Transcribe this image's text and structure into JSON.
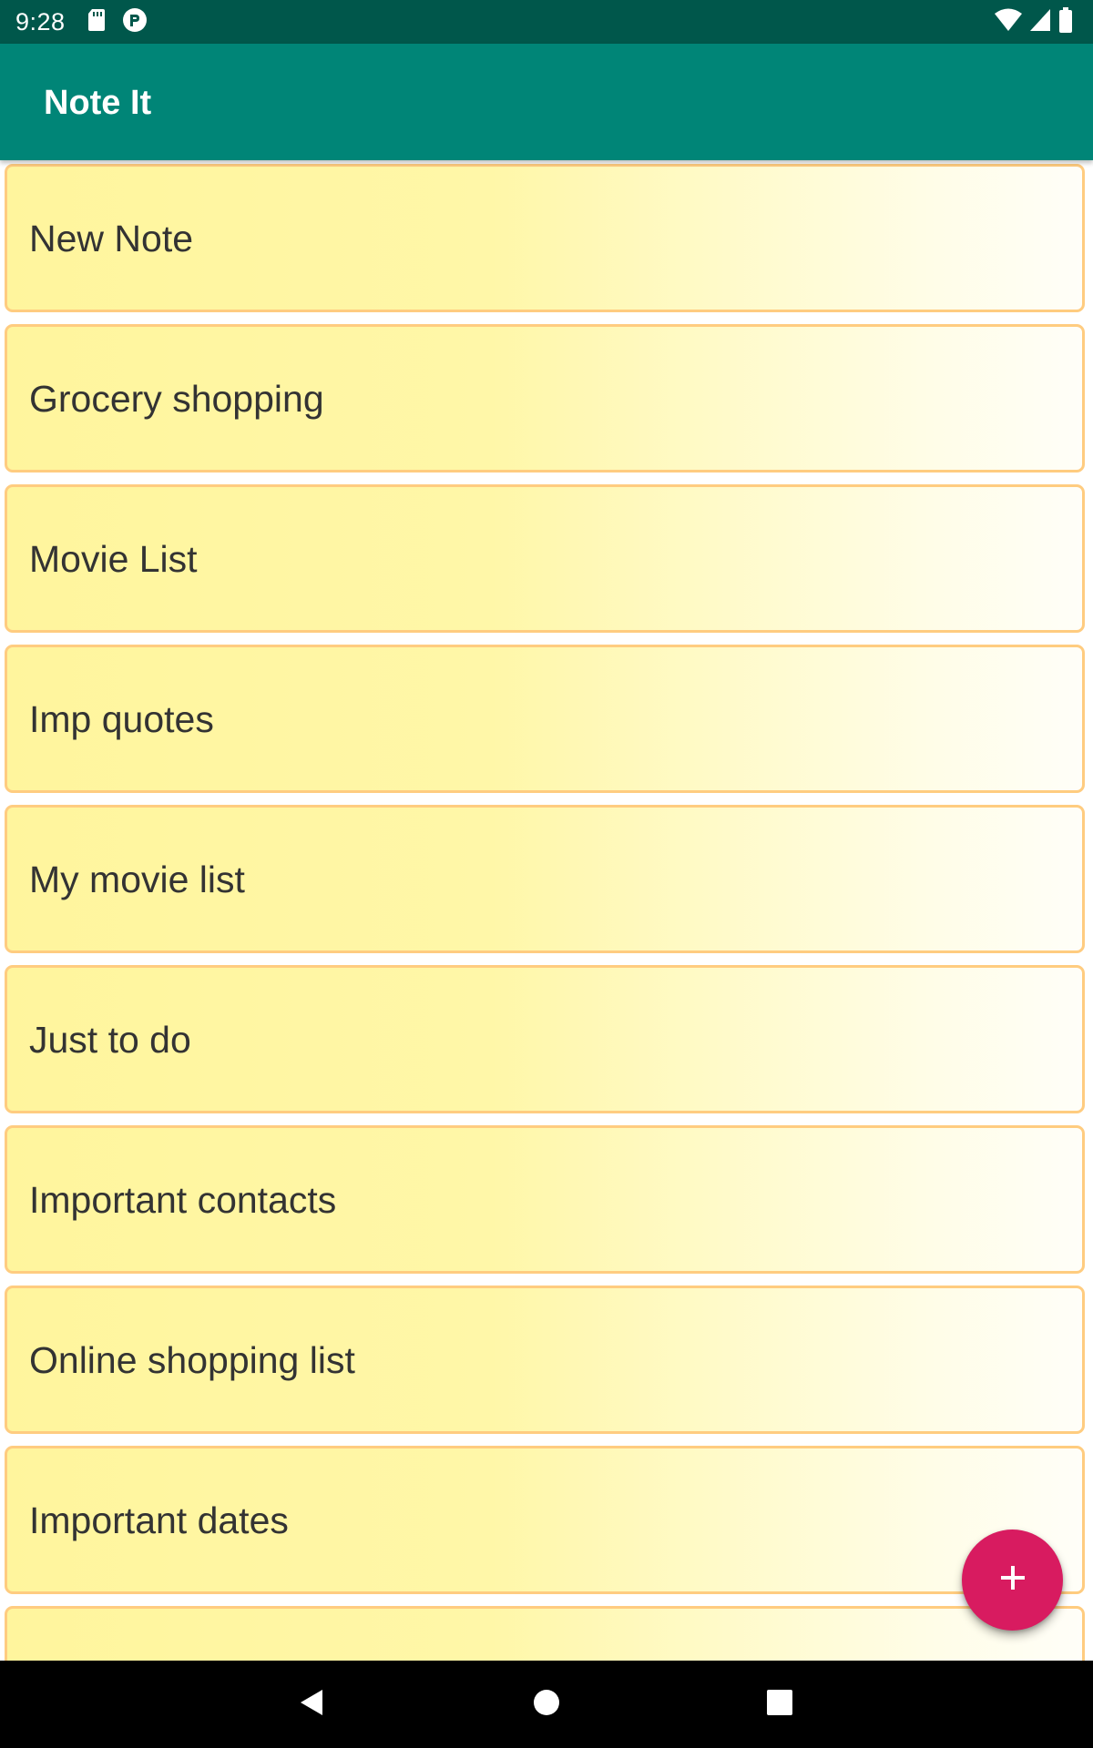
{
  "status_bar": {
    "time": "9:28",
    "left_icons": [
      "sd-card-icon",
      "app-notification-icon"
    ],
    "right_icons": [
      "wifi-icon",
      "cellular-signal-icon",
      "battery-icon"
    ]
  },
  "app_bar": {
    "title": "Note It"
  },
  "notes": [
    {
      "title": "New Note"
    },
    {
      "title": "Grocery shopping"
    },
    {
      "title": "Movie List"
    },
    {
      "title": "Imp quotes"
    },
    {
      "title": "My movie list"
    },
    {
      "title": "Just to do"
    },
    {
      "title": "Important contacts"
    },
    {
      "title": "Online shopping list"
    },
    {
      "title": "Important dates"
    },
    {
      "title": ""
    }
  ],
  "fab": {
    "icon": "plus-icon"
  },
  "nav_bar": {
    "buttons": [
      "back-icon",
      "home-icon",
      "recents-icon"
    ]
  },
  "colors": {
    "status_bar": "#00574b",
    "app_bar": "#008577",
    "fab": "#d81b60",
    "card_border": "#ffcc80",
    "card_fill": "#fff59d"
  }
}
